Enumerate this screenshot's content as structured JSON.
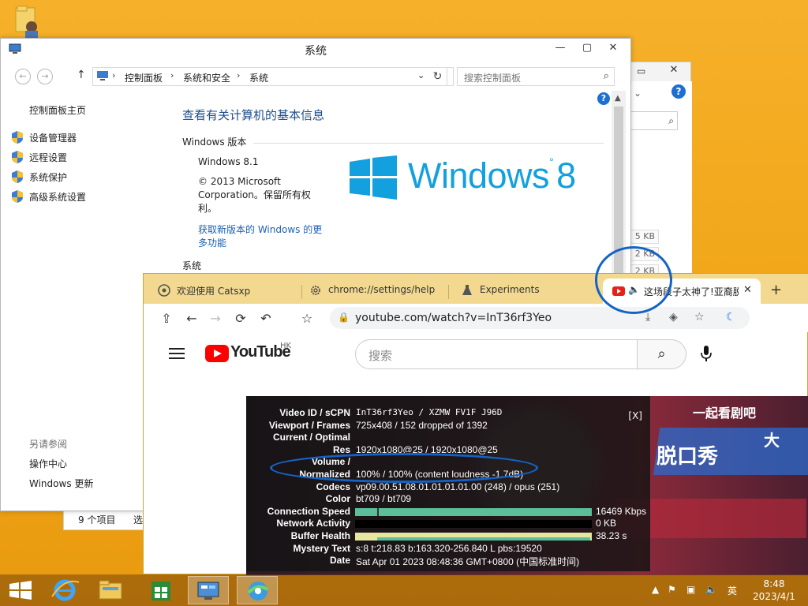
{
  "desktop": {
    "icon": "user-folder-icon"
  },
  "background_window": {
    "sizes": [
      "5 KB",
      "2 KB",
      "2 KB"
    ],
    "status_items": "9 个项目",
    "status_extra": "选"
  },
  "system_window": {
    "title": "系统",
    "breadcrumb": [
      "控制面板",
      "系统和安全",
      "系统"
    ],
    "search_placeholder": "搜索控制面板",
    "sidebar_home": "控制面板主页",
    "sidebar_items": [
      "设备管理器",
      "远程设置",
      "系统保护",
      "高级系统设置"
    ],
    "see_also_label": "另请参阅",
    "see_also_items": [
      "操作中心",
      "Windows 更新"
    ],
    "heading": "查看有关计算机的基本信息",
    "edition_section": "Windows 版本",
    "edition": "Windows 8.1",
    "copyright_line1": "© 2013 Microsoft",
    "copyright_line2": "Corporation。保留所有权",
    "copyright_line3": "利。",
    "upgrade_link1": "获取新版本的 Windows 的更",
    "upgrade_link2": "多功能",
    "system_section": "系统",
    "logo_text": "Windows",
    "logo_version": "8"
  },
  "browser": {
    "tabs": [
      {
        "label": "欢迎使用 Catsxp",
        "icon": "catsxp-icon"
      },
      {
        "label": "chrome://settings/help",
        "icon": "gear-icon"
      },
      {
        "label": "Experiments",
        "icon": "flask-icon"
      }
    ],
    "active_tab": {
      "label": "这场段子太神了!亚裔脱口秀",
      "close": "✕"
    },
    "new_tab": "+",
    "url": "youtube.com/watch?v=InT36rf3Yeo"
  },
  "youtube": {
    "wordmark": "YouTube",
    "region": "HK",
    "search_placeholder": "搜索"
  },
  "video_overlay": {
    "top_text": "一起看剧吧",
    "mid_text": "脱口秀",
    "right_text": "大"
  },
  "stats_for_nerds": {
    "close": "[X]",
    "rows": [
      {
        "k": "Video ID / sCPN",
        "v": "InT36rf3Yeo / XZMW FV1F J96D"
      },
      {
        "k": "Viewport / Frames",
        "v": "725x408 / 152 dropped of 1392"
      },
      {
        "k": "Current / Optimal",
        "v": ""
      },
      {
        "k": "Res",
        "v": "1920x1080@25 / 1920x1080@25"
      },
      {
        "k": "Volume /",
        "v": ""
      },
      {
        "k": "Normalized",
        "v": "100% / 100% (content loudness -1.7dB)"
      },
      {
        "k": "Codecs",
        "v": "vp09.00.51.08.01.01.01.01.00 (248) / opus (251)"
      },
      {
        "k": "Color",
        "v": "bt709 / bt709"
      }
    ],
    "bars": [
      {
        "k": "Connection Speed",
        "v": "16469 Kbps",
        "fill": 1.0,
        "color": "#5bbf9a"
      },
      {
        "k": "Network Activity",
        "v": "0 KB",
        "fill": 0.0,
        "color": "#5bbf9a"
      },
      {
        "k": "Buffer Health",
        "v": "38.23 s",
        "fill": 1.0,
        "color": "#e6e6a0"
      }
    ],
    "tail": [
      {
        "k": "Mystery Text",
        "v": "s:8 t:218.83 b:163.320-256.840 L pbs:19520"
      },
      {
        "k": "Date",
        "v": "Sat Apr 01 2023 08:48:36 GMT+0800 (中国标准时间)"
      }
    ]
  },
  "taskbar": {
    "time": "8:48",
    "date": "2023/4/1",
    "ime": "英",
    "apps": [
      "start-button",
      "internet-explorer-icon",
      "file-explorer-icon",
      "store-icon",
      "control-panel-icon",
      "catsxp-browser-icon"
    ]
  }
}
